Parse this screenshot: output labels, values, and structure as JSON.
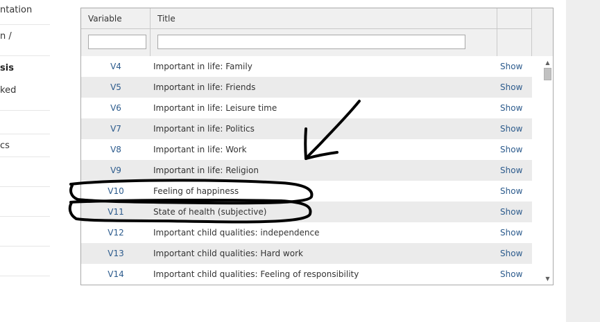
{
  "nav": {
    "items": [
      {
        "label": "ntation",
        "active": false
      },
      {
        "label": "n /",
        "active": false
      },
      {
        "label": "sis",
        "active": true
      },
      {
        "label": "ked",
        "active": false
      },
      {
        "label": "",
        "active": false
      },
      {
        "label": "cs",
        "active": false
      },
      {
        "label": "",
        "active": false
      },
      {
        "label": "",
        "active": false
      },
      {
        "label": "",
        "active": false
      },
      {
        "label": "",
        "active": false
      }
    ]
  },
  "table": {
    "headers": {
      "variable": "Variable",
      "title": "Title"
    },
    "filters": {
      "variable": "",
      "title": ""
    },
    "rows": [
      {
        "variable": "V4",
        "title": "Important in life: Family",
        "action": "Show"
      },
      {
        "variable": "V5",
        "title": "Important in life: Friends",
        "action": "Show"
      },
      {
        "variable": "V6",
        "title": "Important in life: Leisure time",
        "action": "Show"
      },
      {
        "variable": "V7",
        "title": "Important in life: Politics",
        "action": "Show"
      },
      {
        "variable": "V8",
        "title": "Important in life: Work",
        "action": "Show"
      },
      {
        "variable": "V9",
        "title": "Important in life: Religion",
        "action": "Show"
      },
      {
        "variable": "V10",
        "title": "Feeling of happiness",
        "action": "Show"
      },
      {
        "variable": "V11",
        "title": "State of health (subjective)",
        "action": "Show"
      },
      {
        "variable": "V12",
        "title": "Important child qualities: independence",
        "action": "Show"
      },
      {
        "variable": "V13",
        "title": "Important child qualities: Hard work",
        "action": "Show"
      },
      {
        "variable": "V14",
        "title": "Important child qualities: Feeling of responsibility",
        "action": "Show"
      }
    ]
  },
  "scrollbar": {
    "up_icon": "triangle-up",
    "down_icon": "triangle-down"
  },
  "annotation": {
    "color": "#000000",
    "arrow": "hand-drawn-arrow",
    "highlight": "hand-drawn-ellipses"
  }
}
